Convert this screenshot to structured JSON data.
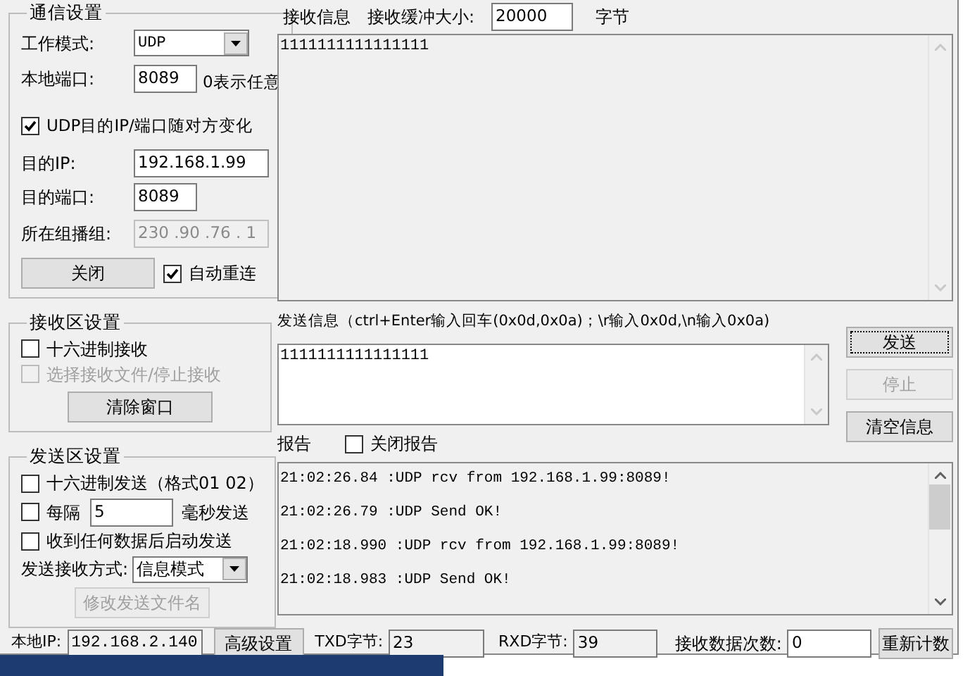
{
  "comm_settings": {
    "title": "通信设置",
    "work_mode": {
      "label": "工作模式:",
      "value": "UDP"
    },
    "local_port": {
      "label": "本地端口:",
      "value": "8089",
      "hint": "0表示任意"
    },
    "follow_peer": {
      "label": "UDP目的IP/端口随对方变化",
      "checked": true
    },
    "dest_ip": {
      "label": "目的IP:",
      "value": "192.168.1.99",
      "disabled": false
    },
    "dest_port": {
      "label": "目的端口:",
      "value": "8089",
      "disabled": false
    },
    "multicast_group": {
      "label": "所在组播组:",
      "value": "230 .90 .76 . 1",
      "disabled": true
    },
    "close_button": "关闭",
    "auto_reconnect": {
      "label": "自动重连",
      "checked": true
    }
  },
  "receive_settings": {
    "title": "接收区设置",
    "options": [
      {
        "label": "十六进制接收",
        "checked": false,
        "disabled": false
      },
      {
        "label": "选择接收文件/停止接收",
        "checked": false,
        "disabled": true
      }
    ],
    "clear_button": "清除窗口"
  },
  "send_settings": {
    "title": "发送区设置",
    "hex_send": {
      "label": "十六进制发送（格式01 02）",
      "checked": false
    },
    "interval": {
      "label": "每隔",
      "value": "5",
      "unit": "毫秒发送",
      "checked": false
    },
    "auto_send": {
      "label": "收到任何数据后启动发送",
      "checked": false
    },
    "mode": {
      "label": "发送接收方式:",
      "value": "信息模式"
    },
    "file_button": {
      "label": "修改发送文件名",
      "disabled": true
    }
  },
  "receive": {
    "label": "接收信息",
    "buffer_label": "接收缓冲大小:",
    "buffer_value": "20000",
    "buffer_unit": "字节",
    "text": "1111111111111111"
  },
  "send": {
    "label": "发送信息（ctrl+Enter输入回车(0x0d,0x0a)；\\r输入0x0d,\\n输入0x0a)",
    "text": "1111111111111111"
  },
  "buttons": [
    {
      "label": "发送",
      "disabled": false,
      "focused": true
    },
    {
      "label": "停止",
      "disabled": true,
      "focused": false
    },
    {
      "label": "清空信息",
      "disabled": false,
      "focused": false
    }
  ],
  "report": {
    "label": "报告",
    "close_report": {
      "label": "关闭报告",
      "checked": false
    },
    "lines": [
      "21:02:26.84 :UDP rcv from 192.168.1.99:8089!",
      "21:02:26.79 :UDP Send OK!",
      "21:02:18.990 :UDP rcv from 192.168.1.99:8089!",
      "21:02:18.983 :UDP Send OK!"
    ]
  },
  "status_bar": {
    "local_ip": {
      "label": "本地IP:",
      "value": "192.168.2.140"
    },
    "advanced_button": "高级设置",
    "txd": {
      "label": "TXD字节:",
      "value": "23"
    },
    "rxd": {
      "label": "RXD字节:",
      "value": "39"
    },
    "rx_count": {
      "label": "接收数据次数:",
      "value": "0"
    },
    "reset_button": "重新计数"
  }
}
